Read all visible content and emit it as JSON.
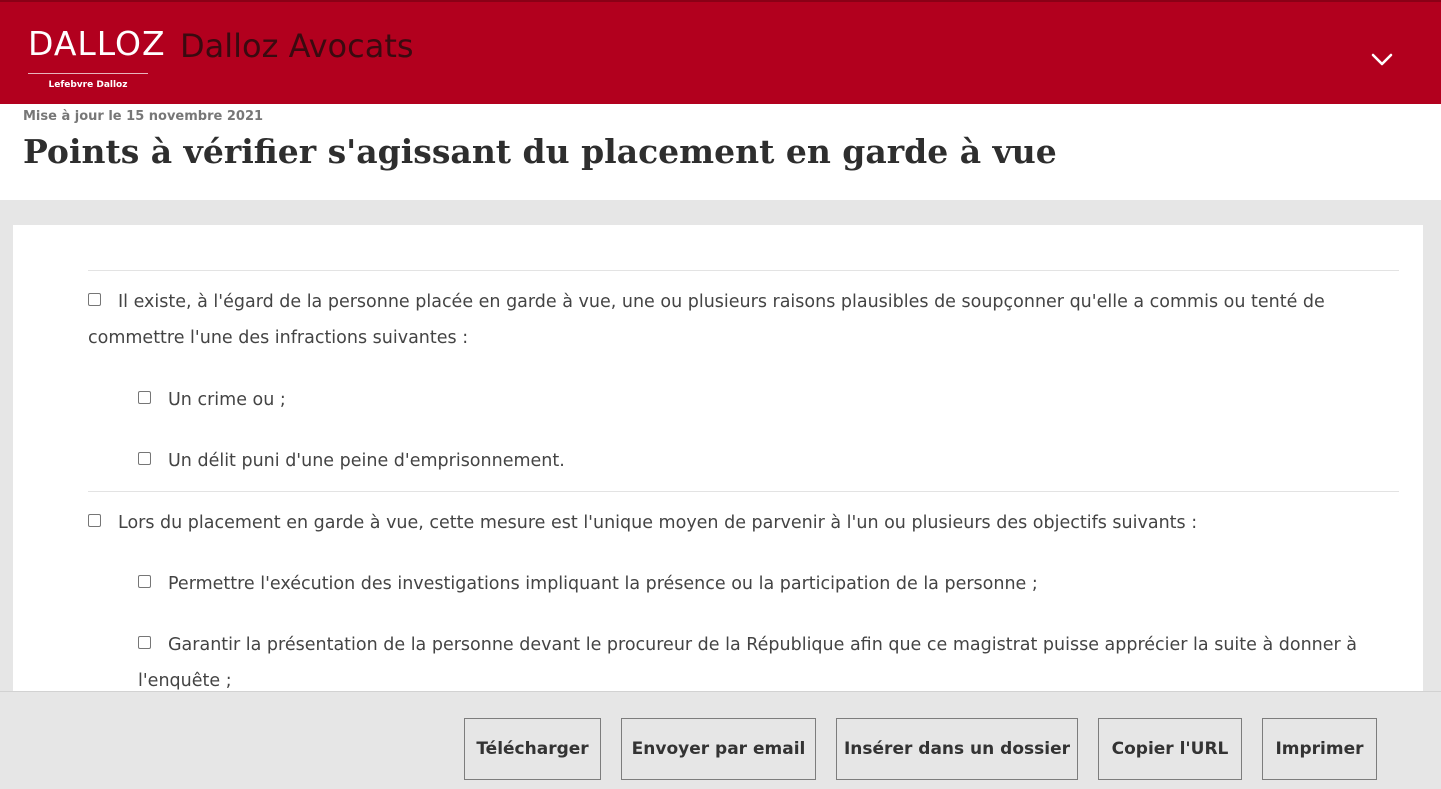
{
  "header": {
    "logo_text": "DALLOZ",
    "logo_subtext": "Lefebvre Dalloz",
    "brand_name": "Dalloz Avocats",
    "menu_icon": "chevron-down-icon",
    "background_color": "#b2001e"
  },
  "article": {
    "updated": "Mise à jour le 15 novembre 2021",
    "title": "Points à vérifier s'agissant du placement en garde à vue"
  },
  "checklist": [
    {
      "text": "Il existe, à l'égard de la personne placée en garde à vue, une ou plusieurs raisons plausibles de soupçonner qu'elle a commis ou tenté de commettre l'une des infractions suivantes :",
      "checked": false,
      "subitems": [
        {
          "text": "Un crime ou ;",
          "checked": false
        },
        {
          "text": "Un délit puni d'une peine d'emprisonnement.",
          "checked": false
        }
      ]
    },
    {
      "text": "Lors du placement en garde à vue, cette mesure est l'unique moyen de parvenir à l'un ou plusieurs des objectifs suivants :",
      "checked": false,
      "subitems": [
        {
          "text": "Permettre l'exécution des investigations impliquant la présence ou la participation de la personne ;",
          "checked": false
        },
        {
          "text": "Garantir la présentation de la personne devant le procureur de la République afin que ce magistrat puisse apprécier la suite à donner à l'enquête ;",
          "checked": false
        }
      ]
    }
  ],
  "actions": {
    "download": "Télécharger",
    "email": "Envoyer par email",
    "insert_folder": "Insérer dans un dossier",
    "copy_url": "Copier l'URL",
    "print": "Imprimer"
  }
}
